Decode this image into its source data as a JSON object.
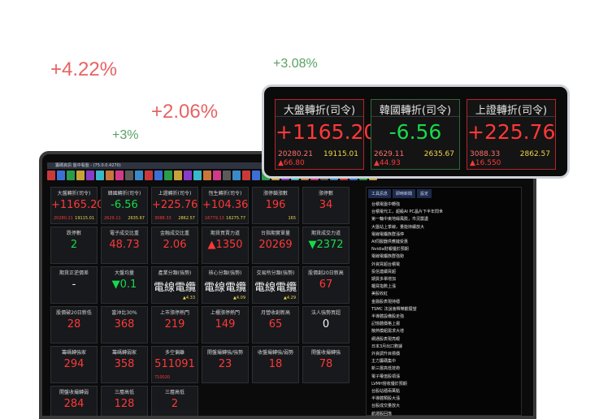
{
  "floating": {
    "pct_red_a": "+4.22%",
    "pct_red_b": "+2.06%",
    "pct_green_a": "+3.08%",
    "pct_green_b": "+3%"
  },
  "window": {
    "title": "籌碼資訊 盤中看盤 - (75.0.0.4270)"
  },
  "tiles": [
    {
      "title": "大盤轉折(司令)",
      "value": "+1165.20",
      "color": "red",
      "sub_left": "20280.21",
      "sub_right": "19115.01"
    },
    {
      "title": "韓國轉折(司令)",
      "value": "-6.56",
      "color": "green",
      "sub_left": "2629.11",
      "sub_right": "2635.67"
    },
    {
      "title": "上證轉折(司令)",
      "value": "+225.76",
      "color": "red",
      "sub_left": "3088.33",
      "sub_right": "2862.57"
    },
    {
      "title": "恆生轉折(司令)",
      "value": "+104.36",
      "color": "red",
      "sub_left": "16779.13",
      "sub_right": "16275.77"
    },
    {
      "title": "漲停鎖漲數",
      "value": "196",
      "color": "red",
      "sub_left": "",
      "sub_right": "165"
    },
    {
      "title": "漲停數",
      "value": "34",
      "color": "red",
      "sub_left": "",
      "sub_right": ""
    },
    {
      "title": "跌停數",
      "value": "2",
      "color": "green",
      "sub_left": "",
      "sub_right": ""
    },
    {
      "title": "電子成交比重",
      "value": "48.73",
      "color": "red",
      "sub_left": "",
      "sub_right": ""
    },
    {
      "title": "金融成交比重",
      "value": "2.06",
      "color": "red",
      "sub_left": "",
      "sub_right": ""
    },
    {
      "title": "期貨買賣力道",
      "value": "▲1350",
      "color": "red",
      "sub_left": "",
      "sub_right": ""
    },
    {
      "title": "台指期實單量",
      "value": "20269",
      "color": "red",
      "sub_left": "",
      "sub_right": ""
    },
    {
      "title": "期貨成交力道",
      "value": "▼2372",
      "color": "green",
      "sub_left": "",
      "sub_right": ""
    },
    {
      "title": "期貨正逆價差",
      "value": "-",
      "color": "white",
      "sub_left": "",
      "sub_right": ""
    },
    {
      "title": "大盤均量",
      "value": "▼0.1",
      "color": "green",
      "sub_left": "",
      "sub_right": ""
    },
    {
      "title": "產業分類(強勢)",
      "value": "電線電纜",
      "color": "white",
      "sub_left": "",
      "sub_right": "▲4.33"
    },
    {
      "title": "核心分類(強勢)",
      "value": "電線電纜",
      "color": "white",
      "sub_left": "",
      "sub_right": "▲4.09"
    },
    {
      "title": "交易所分類(強勢)",
      "value": "電線電纜",
      "color": "white",
      "sub_left": "",
      "sub_right": "▲4.29"
    },
    {
      "title": "股價創20日新高",
      "value": "67",
      "color": "red",
      "sub_left": "",
      "sub_right": ""
    },
    {
      "title": "股價破20日新低",
      "value": "28",
      "color": "red",
      "sub_left": "",
      "sub_right": ""
    },
    {
      "title": "當沖比30%",
      "value": "368",
      "color": "red",
      "sub_left": "",
      "sub_right": ""
    },
    {
      "title": "上市漲停熱門",
      "value": "219",
      "color": "red",
      "sub_left": "",
      "sub_right": ""
    },
    {
      "title": "上櫃漲停熱門",
      "value": "149",
      "color": "red",
      "sub_left": "",
      "sub_right": ""
    },
    {
      "title": "月營收創新高",
      "value": "65",
      "color": "red",
      "sub_left": "",
      "sub_right": ""
    },
    {
      "title": "法人強勢買超",
      "value": "0",
      "color": "white",
      "sub_left": "",
      "sub_right": ""
    },
    {
      "title": "籌碼轉強家",
      "value": "294",
      "color": "red",
      "sub_left": "",
      "sub_right": ""
    },
    {
      "title": "籌碼轉弱家",
      "value": "358",
      "color": "red",
      "sub_left": "",
      "sub_right": ""
    },
    {
      "title": "多空偏離",
      "value": "511091",
      "color": "red",
      "sub_left": "710020",
      "sub_right": ""
    },
    {
      "title": "開盤撮轉強/強勢",
      "value": "23",
      "color": "red",
      "sub_left": "",
      "sub_right": ""
    },
    {
      "title": "收盤撮轉強/弱勢",
      "value": "18",
      "color": "red",
      "sub_left": "",
      "sub_right": ""
    },
    {
      "title": "開盤收撮轉強",
      "value": "78",
      "color": "red",
      "sub_left": "",
      "sub_right": ""
    },
    {
      "title": "開盤收撮轉弱",
      "value": "284",
      "color": "red",
      "sub_left": "",
      "sub_right": ""
    },
    {
      "title": "三層高低",
      "value": "128",
      "color": "red",
      "sub_left": "",
      "sub_right": ""
    },
    {
      "title": "三層高低",
      "value": "2",
      "color": "red",
      "sub_left": "",
      "sub_right": ""
    }
  ],
  "side_tabs": [
    "工具訊息",
    "即時新聞",
    "設定"
  ],
  "side_items": [
    "台積電盤中轉強",
    "台積電代工，超級AI PC晶片下半年問世",
    "第一輪中東地緣風險，市況震盪",
    "大盤站上季線，量能持續放大",
    "電線電纜族群漲停",
    "AI伺服器供應鏈受惠",
    "Nvidia財報優於預期",
    "電線電纜族群強勢",
    "外資買超台積電",
    "投信連續買超",
    "期貨多單增加",
    "櫃買指數上漲",
    "美股收紅",
    "金融股表現持穩",
    "TSMC 法說會釋樂觀展望",
    "半導體設備股走強",
    "記憶體價格上揚",
    "散熱模組需求大增",
    "網通股表現亮眼",
    "日本3月出口數據",
    "外資調升目標價",
    "主力籌碼集中",
    "新三層高低技術",
    "電子權值股領漲",
    "LVMH營收優於預期",
    "台股站穩兩萬點",
    "半導體類股大漲",
    "台股成交量放大",
    "航運股回落",
    "連漲多日後整理"
  ],
  "callout": {
    "tiles": [
      {
        "title": "大盤轉折(司令)",
        "value": "+1165.20",
        "color": "red",
        "left": "20280.21",
        "right": "19115.01",
        "change": "▲66.80"
      },
      {
        "title": "韓國轉折(司令)",
        "value": "-6.56",
        "color": "green",
        "left": "2629.11",
        "right": "2635.67",
        "change": "▲44.93"
      },
      {
        "title": "上證轉折(司令)",
        "value": "+225.76",
        "color": "red",
        "left": "3088.33",
        "right": "2862.57",
        "change": "▲16.550"
      }
    ]
  },
  "colors": {
    "red": "#ff3838",
    "green": "#18d94a",
    "white": "#f2f2f2"
  }
}
